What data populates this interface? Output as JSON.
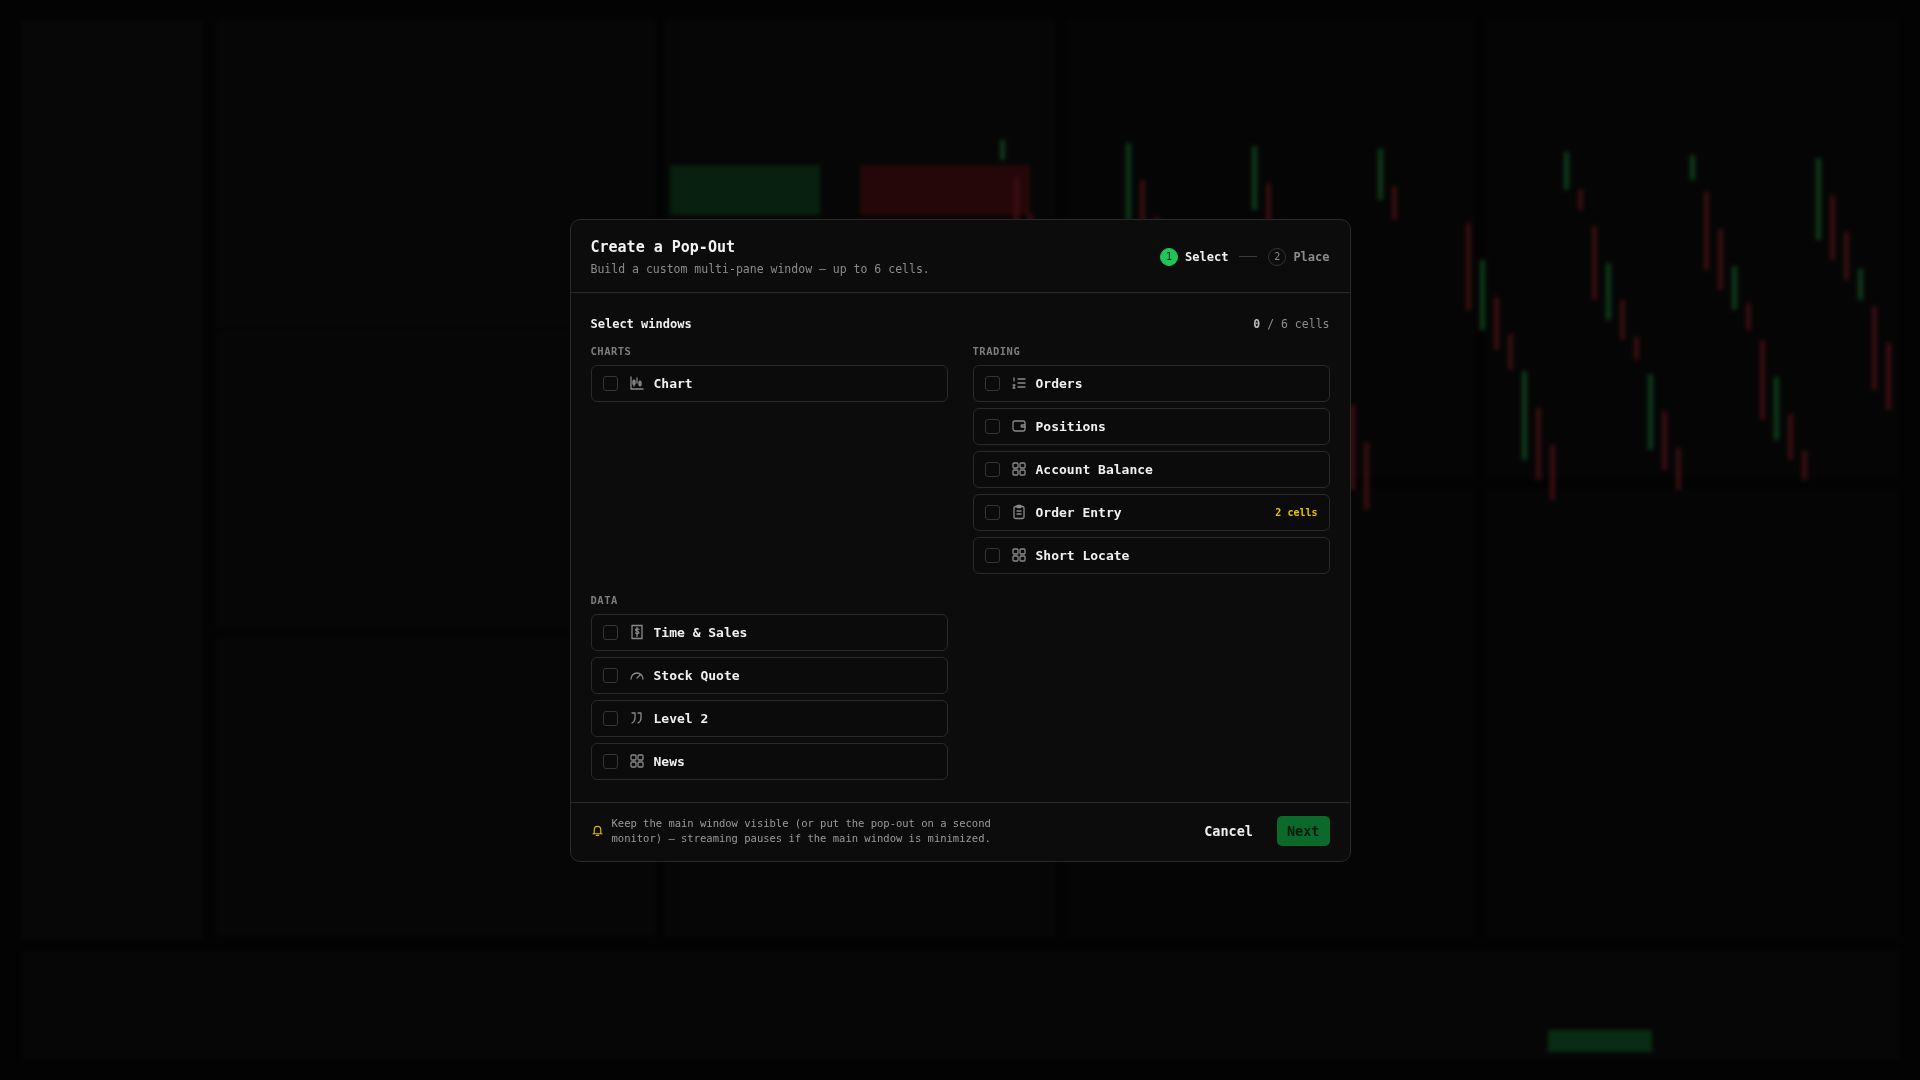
{
  "dialog": {
    "title": "Create a Pop-Out",
    "subtitle": "Build a custom multi-pane window — up to 6 cells.",
    "steps": [
      {
        "number": "1",
        "label": "Select",
        "selected": true
      },
      {
        "number": "2",
        "label": "Place",
        "selected": false
      }
    ],
    "section_title": "Select windows",
    "count": "**0** / 6 cells",
    "groups": [
      {
        "label": "CHARTS",
        "items": [
          {
            "label": "Chart",
            "kind": "chart",
            "checked": false
          }
        ]
      },
      {
        "label": "TRADING",
        "items": [
          {
            "label": "Orders",
            "kind": "list",
            "checked": false
          },
          {
            "label": "Positions",
            "kind": "wallet",
            "checked": false
          },
          {
            "label": "Account Balance",
            "kind": "grid",
            "checked": false
          },
          {
            "label": "Order Entry",
            "kind": "clipboard",
            "checked": false,
            "badge": "2 cells"
          },
          {
            "label": "Short Locate",
            "kind": "grid",
            "checked": false
          }
        ]
      },
      {
        "label": "DATA",
        "items": [
          {
            "label": "Time & Sales",
            "kind": "receipt",
            "checked": false
          },
          {
            "label": "Stock Quote",
            "kind": "gauge",
            "checked": false
          },
          {
            "label": "Level 2",
            "kind": "quote",
            "checked": false
          },
          {
            "label": "News",
            "kind": "grid",
            "checked": false
          }
        ]
      }
    ],
    "note": "Keep the main window visible (or put the pop-out on a second monitor) — streaming pauses if the main window is minimized.",
    "buttons": [
      {
        "label": "Cancel",
        "kind": "secondary"
      },
      {
        "label": "Next",
        "kind": "primary"
      }
    ]
  }
}
